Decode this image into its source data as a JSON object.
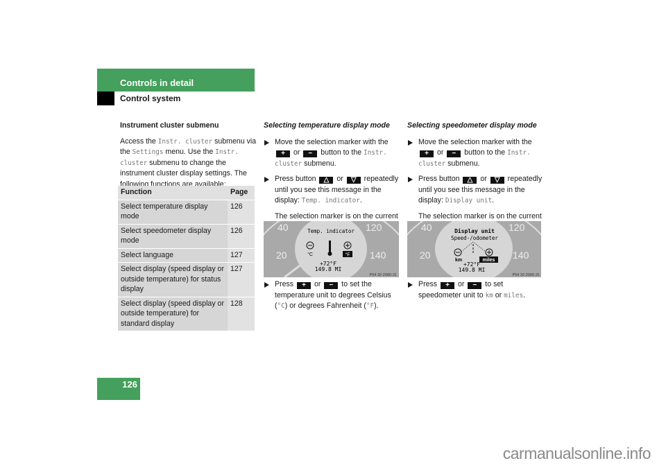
{
  "header": {
    "section": "Controls in detail",
    "subsection": "Control system"
  },
  "col1": {
    "heading": "Instrument cluster submenu",
    "p1": "Access the ",
    "m1": "Instr. cluster",
    "p2": " submenu via the ",
    "m2": "Settings",
    "p3": " menu. Use the ",
    "m3": "Instr. cluster",
    "p4": " submenu to change the instrument cluster display settings. The following functions are available:",
    "table": {
      "headers": [
        "Function",
        "Page"
      ],
      "rows": [
        [
          "Select temperature display mode",
          "126"
        ],
        [
          "Select speedometer display mode",
          "126"
        ],
        [
          "Select language",
          "127"
        ],
        [
          "Select display (speed display or outside temperature) for status display",
          "127"
        ],
        [
          "Select display (speed display or outside temperature) for standard display",
          "128"
        ]
      ]
    }
  },
  "col2": {
    "heading": "Selecting temperature display mode",
    "b1a": "Move the selection marker with the ",
    "or": " or ",
    "b1b": " button to the ",
    "b1m": "Instr. cluster",
    "b1c": " submenu.",
    "b2a": "Press button ",
    "b2b": " repeatedly until you see this message in the display: ",
    "b2m": "Temp. indicator",
    "dot": ".",
    "note": "The selection marker is on the current setting.",
    "image": {
      "title": "Temp. indicator",
      "left_unit": "°C",
      "right_unit": "°F",
      "temp": "+72°F",
      "odo": "149.8 MI",
      "code": "P54 32-2080-31",
      "ticks": [
        "20",
        "40",
        "120",
        "140"
      ]
    },
    "b3a": "Press ",
    "b3b": " to set the temperature unit to degrees Celsius (",
    "m_c": "°C",
    "b3c": ") or degrees Fahrenheit (",
    "m_f": "°F",
    "b3d": ")."
  },
  "col3": {
    "heading": "Selecting speedometer display mode",
    "b1a": "Move the selection marker with the ",
    "or": " or ",
    "b1b": " button to the ",
    "b1m": "Instr. cluster",
    "b1c": " submenu.",
    "b2a": "Press button ",
    "b2b": " repeatedly until you see this message in the display: ",
    "b2m": "Display unit",
    "dot": ".",
    "note": "The selection marker is on the current setting.",
    "image": {
      "title": "Display unit",
      "title2": "Speed-/odometer",
      "left_unit": "km",
      "right_unit": "miles",
      "temp": "+72°F",
      "odo": "149.8 MI",
      "code": "P54 32-2066-31",
      "ticks": [
        "20",
        "40",
        "120",
        "140"
      ]
    },
    "b3a": "Press ",
    "b3b": " to set speedometer unit to ",
    "m_km": "km",
    "b3c": " or ",
    "m_mi": "miles",
    "b3d": "."
  },
  "buttons": {
    "plus": "+",
    "minus": "−",
    "up": "△",
    "down": "▽"
  },
  "page_number": "126",
  "watermark": "carmanualsonline.info",
  "colors": {
    "green": "#44a05c"
  }
}
